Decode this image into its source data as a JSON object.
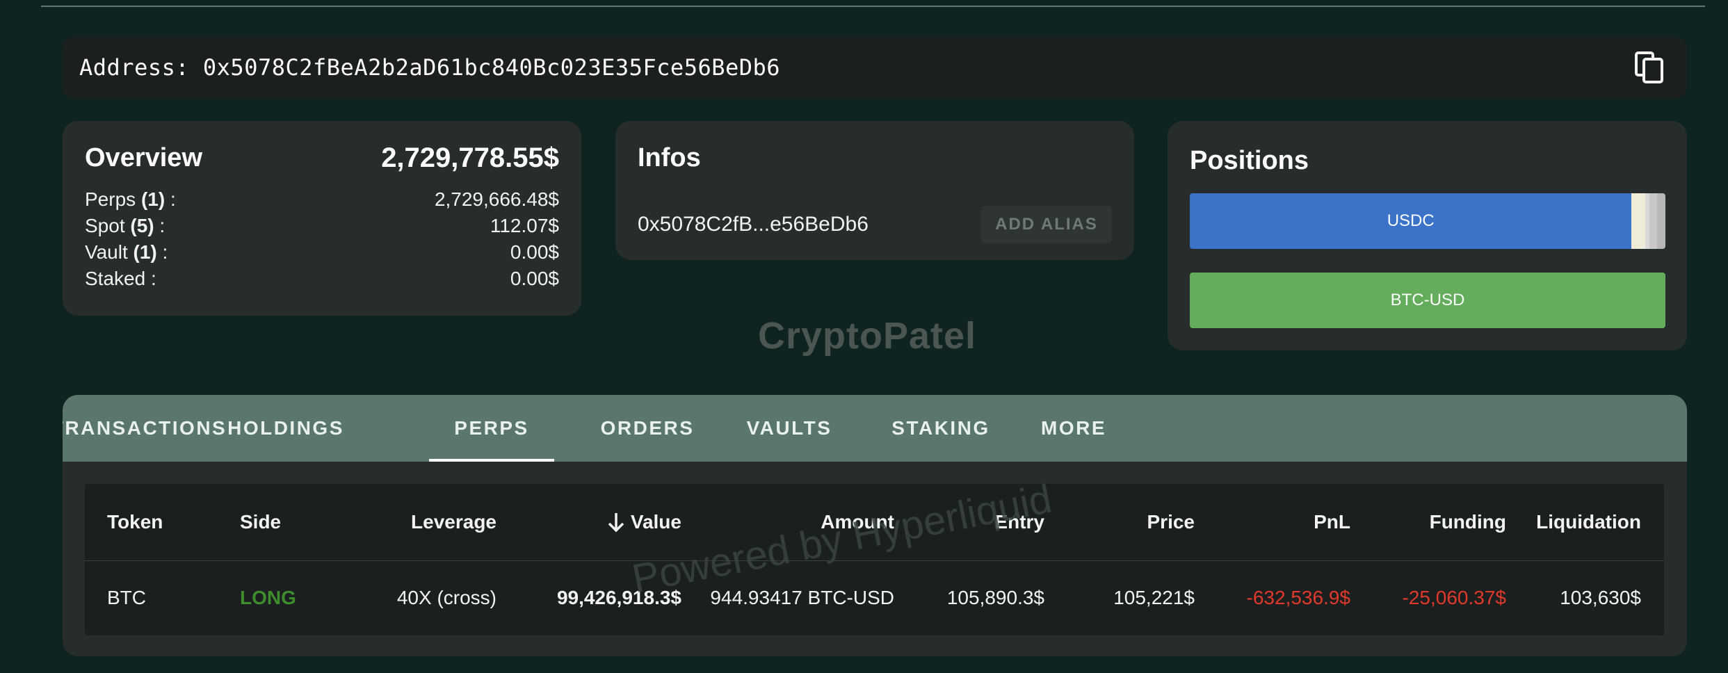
{
  "address_bar": {
    "text": "Address: 0x5078C2fBeA2b2aD61bc840Bc023E35Fce56BeDb6",
    "copy_icon": "copy-icon"
  },
  "overview": {
    "title": "Overview",
    "total": "2,729,778.55$",
    "rows": [
      {
        "label": "Perps",
        "count": "(1)",
        "suffix": " :",
        "value": "2,729,666.48$"
      },
      {
        "label": "Spot",
        "count": "(5)",
        "suffix": " :",
        "value": "112.07$"
      },
      {
        "label": "Vault",
        "count": "(1)",
        "suffix": " :",
        "value": "0.00$"
      },
      {
        "label": "Staked",
        "count": "",
        "suffix": " :",
        "value": "0.00$"
      }
    ]
  },
  "infos": {
    "title": "Infos",
    "short_address": "0x5078C2fB...e56BeDb6",
    "alias_button": "ADD ALIAS"
  },
  "positions": {
    "title": "Positions",
    "bars": [
      {
        "name": "usdc",
        "segments": [
          {
            "label": "USDC",
            "share": 0.929,
            "color": "#3b73c8"
          },
          {
            "label": "",
            "share": 0.029,
            "color": "#efedd9"
          },
          {
            "label": "",
            "share": 0.009,
            "color": "#d9d9d9"
          },
          {
            "label": "",
            "share": 0.016,
            "color": "#c8c8c8"
          },
          {
            "label": "",
            "share": 0.017,
            "color": "#b8b8b8"
          }
        ]
      },
      {
        "name": "btc-usd",
        "segments": [
          {
            "label": "BTC-USD",
            "share": 1.0,
            "color": "#64ad5d"
          }
        ]
      }
    ]
  },
  "watermark": "CryptoPatel",
  "grid_watermark": "Powered by Hyperliquid",
  "tabs": [
    {
      "label": "TRANSACTIONS",
      "active": false
    },
    {
      "label": "HOLDINGS",
      "active": false
    },
    {
      "label": "PERPS",
      "active": true
    },
    {
      "label": "ORDERS",
      "active": false
    },
    {
      "label": "VAULTS",
      "active": false
    },
    {
      "label": "STAKING",
      "active": false
    },
    {
      "label": "MORE",
      "active": false
    }
  ],
  "table": {
    "sort_icon": "arrow-down-icon",
    "columns": [
      "Token",
      "Side",
      "Leverage",
      "Value",
      "Amount",
      "Entry",
      "Price",
      "PnL",
      "Funding",
      "Liquidation"
    ],
    "rows": [
      [
        "BTC",
        "LONG",
        "40X (cross)",
        "99,426,918.3$",
        "944.93417 BTC-USD",
        "105,890.3$",
        "105,221$",
        "-632,536.9$",
        "-25,060.37$",
        "103,630$"
      ]
    ]
  },
  "colors": {
    "long": "#3f8c2f",
    "negative": "#e0392b",
    "tabs_bg": "#5a766f",
    "page_bg": "#0f2320",
    "card_bg": "#272c2c"
  }
}
